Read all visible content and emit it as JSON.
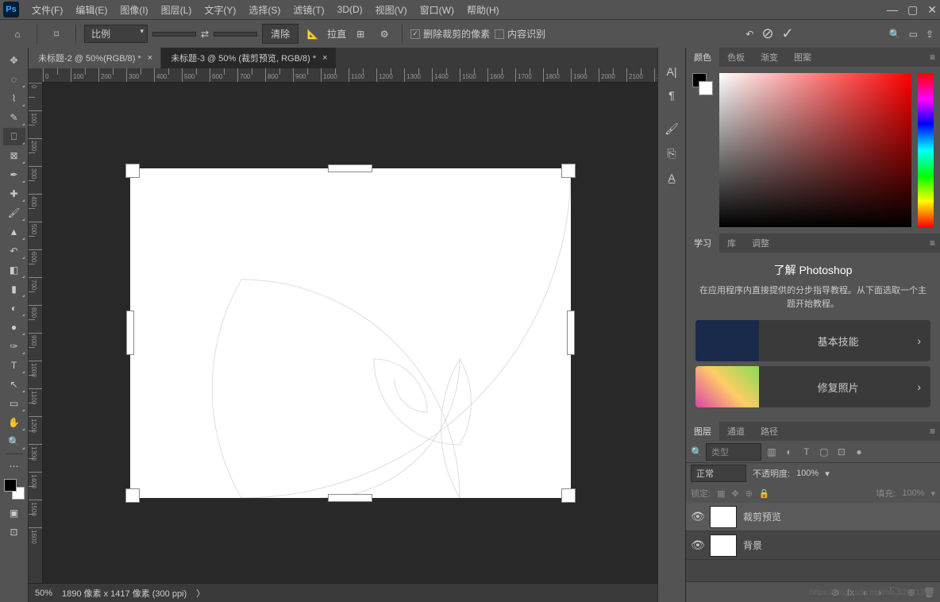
{
  "app": {
    "name": "Ps"
  },
  "menu": {
    "file": "文件(F)",
    "edit": "编辑(E)",
    "image": "图像(I)",
    "layer": "图层(L)",
    "type": "文字(Y)",
    "select": "选择(S)",
    "filter": "滤镜(T)",
    "threed": "3D(D)",
    "view": "视图(V)",
    "window": "窗口(W)",
    "help": "帮助(H)"
  },
  "options": {
    "ratio_label": "比例",
    "clear": "清除",
    "straighten": "拉直",
    "delete_cropped": "删除裁剪的像素",
    "content_aware": "内容识别",
    "delete_checked": "✓",
    "content_checked": ""
  },
  "tabs": {
    "t1": "未标题-2 @ 50%(RGB/8) *",
    "t2": "未标题-3 @ 50% (裁剪预览, RGB/8) *"
  },
  "status": {
    "zoom": "50%",
    "info": "1890 像素 x 1417 像素 (300 ppi)",
    "arrow": "〉"
  },
  "panelTabs": {
    "color": "颜色",
    "swatches": "色板",
    "gradients": "渐变",
    "patterns": "图案",
    "learn": "学习",
    "libraries": "库",
    "adjustments": "调整",
    "layers": "图层",
    "channels": "通道",
    "paths": "路径"
  },
  "learn": {
    "title": "了解 Photoshop",
    "subtitle": "在应用程序内直接提供的分步指导教程。从下面选取一个主题开始教程。",
    "card1": "基本技能",
    "card2": "修复照片"
  },
  "layers": {
    "search_placeholder": "类型",
    "blend_mode": "正常",
    "opacity_label": "不透明度:",
    "opacity_val": "100%",
    "lock_label": "锁定:",
    "fill_label": "填充:",
    "fill_val": "100%",
    "layer1": "裁剪预览",
    "layer2": "背景"
  },
  "watermark": "https://blog.csdn.net/m0_52571370"
}
